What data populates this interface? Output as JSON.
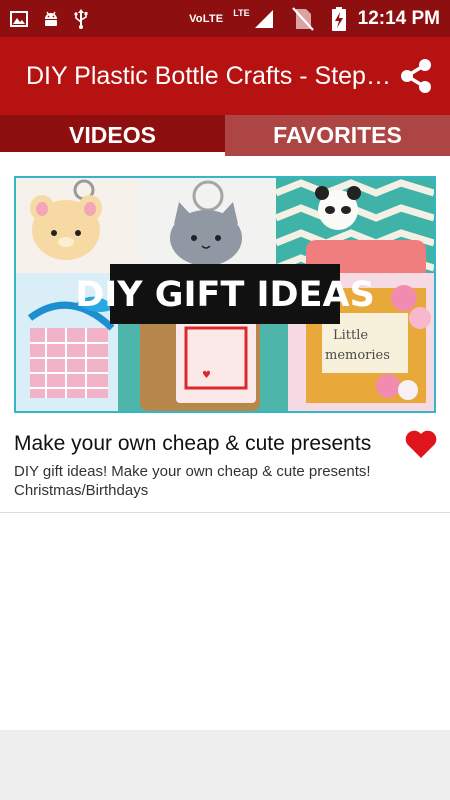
{
  "status_bar": {
    "volte": "VoLTE",
    "lte": "LTE",
    "time": "12:14 PM",
    "icons": [
      "gallery-icon",
      "android-icon",
      "usb-icon",
      "signal-icon",
      "no-sim-icon",
      "battery-charging-icon"
    ]
  },
  "toolbar": {
    "title": "DIY Plastic Bottle Crafts - Step by Step",
    "share_icon": "share-icon"
  },
  "tabs": [
    {
      "label": "VIDEOS",
      "active": true
    },
    {
      "label": "FAVORITES",
      "active": false
    }
  ],
  "videos": [
    {
      "thumbnail_caption": "DIY GIFT IDEAS",
      "thumbnail_text_2": "Little memories",
      "title": "Make your own cheap & cute presents",
      "description": "DIY gift ideas! Make your own cheap & cute presents! Christmas/Birthdays",
      "favorite": true
    }
  ],
  "colors": {
    "status_bar": "#8e0f0f",
    "toolbar": "#b71212",
    "tab_inactive": "#ad4545",
    "favorite": "#e0151b",
    "thumb_border": "#35b6c7"
  }
}
